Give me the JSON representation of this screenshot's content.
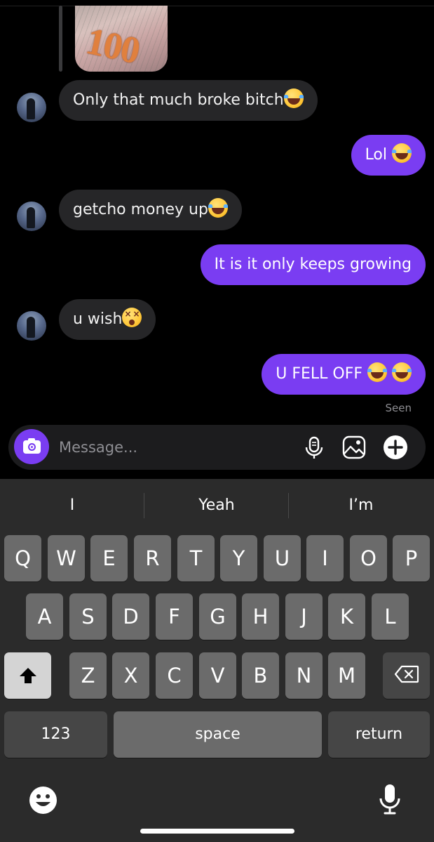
{
  "conversation": {
    "image_caption": "100",
    "messages": [
      {
        "side": "in",
        "text": "Only that much broke bitch",
        "emoji": [
          "face-with-tears-of-joy"
        ]
      },
      {
        "side": "out",
        "text": "Lol ",
        "emoji": [
          "face-with-tears-of-joy"
        ]
      },
      {
        "side": "in",
        "text": "getcho money up",
        "emoji": [
          "face-with-tears-of-joy"
        ]
      },
      {
        "side": "out",
        "text": "It is it only keeps growing",
        "emoji": []
      },
      {
        "side": "in",
        "text": "u wish",
        "emoji": [
          "dizzy-face"
        ]
      },
      {
        "side": "out",
        "text": "U FELL OFF ",
        "emoji": [
          "face-with-tears-of-joy",
          "face-with-tears-of-joy"
        ]
      }
    ],
    "status": "Seen"
  },
  "composer": {
    "placeholder": "Message...",
    "icons": [
      "camera-icon",
      "microphone-icon",
      "gallery-icon",
      "add-icon"
    ]
  },
  "keyboard": {
    "suggestions": [
      "I",
      "Yeah",
      "I’m"
    ],
    "row1": [
      "Q",
      "W",
      "E",
      "R",
      "T",
      "Y",
      "U",
      "I",
      "O",
      "P"
    ],
    "row2": [
      "A",
      "S",
      "D",
      "F",
      "G",
      "H",
      "J",
      "K",
      "L"
    ],
    "row3": [
      "Z",
      "X",
      "C",
      "V",
      "B",
      "N",
      "M"
    ],
    "numbers_label": "123",
    "space_label": "space",
    "return_label": "return",
    "icons": [
      "shift-icon",
      "backspace-icon",
      "emoji-icon",
      "dictation-icon"
    ]
  },
  "colors": {
    "accent": "#7a3df2",
    "incoming_bubble": "#262628",
    "background": "#000000",
    "keyboard": "#2b2b2b"
  }
}
